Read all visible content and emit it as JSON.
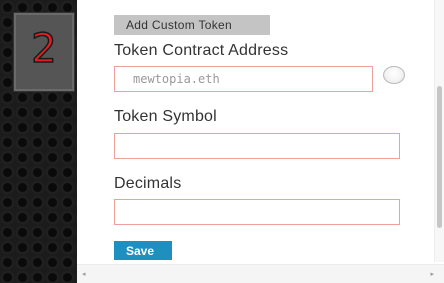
{
  "step_badge": {
    "number": "2"
  },
  "form": {
    "title": "Add Custom Token",
    "contract_address": {
      "label": "Token Contract Address",
      "placeholder": "mewtopia.eth",
      "value": ""
    },
    "symbol": {
      "label": "Token Symbol",
      "value": ""
    },
    "decimals": {
      "label": "Decimals",
      "value": ""
    },
    "save_label": "Save"
  },
  "scrollbars": {
    "left_arrow": "◂",
    "right_arrow": "▸"
  },
  "colors": {
    "badge_number": "#e91c24",
    "input_border": "#f0a09a",
    "save_button": "#1f8fc0",
    "title_pill": "#c4c4c4"
  }
}
